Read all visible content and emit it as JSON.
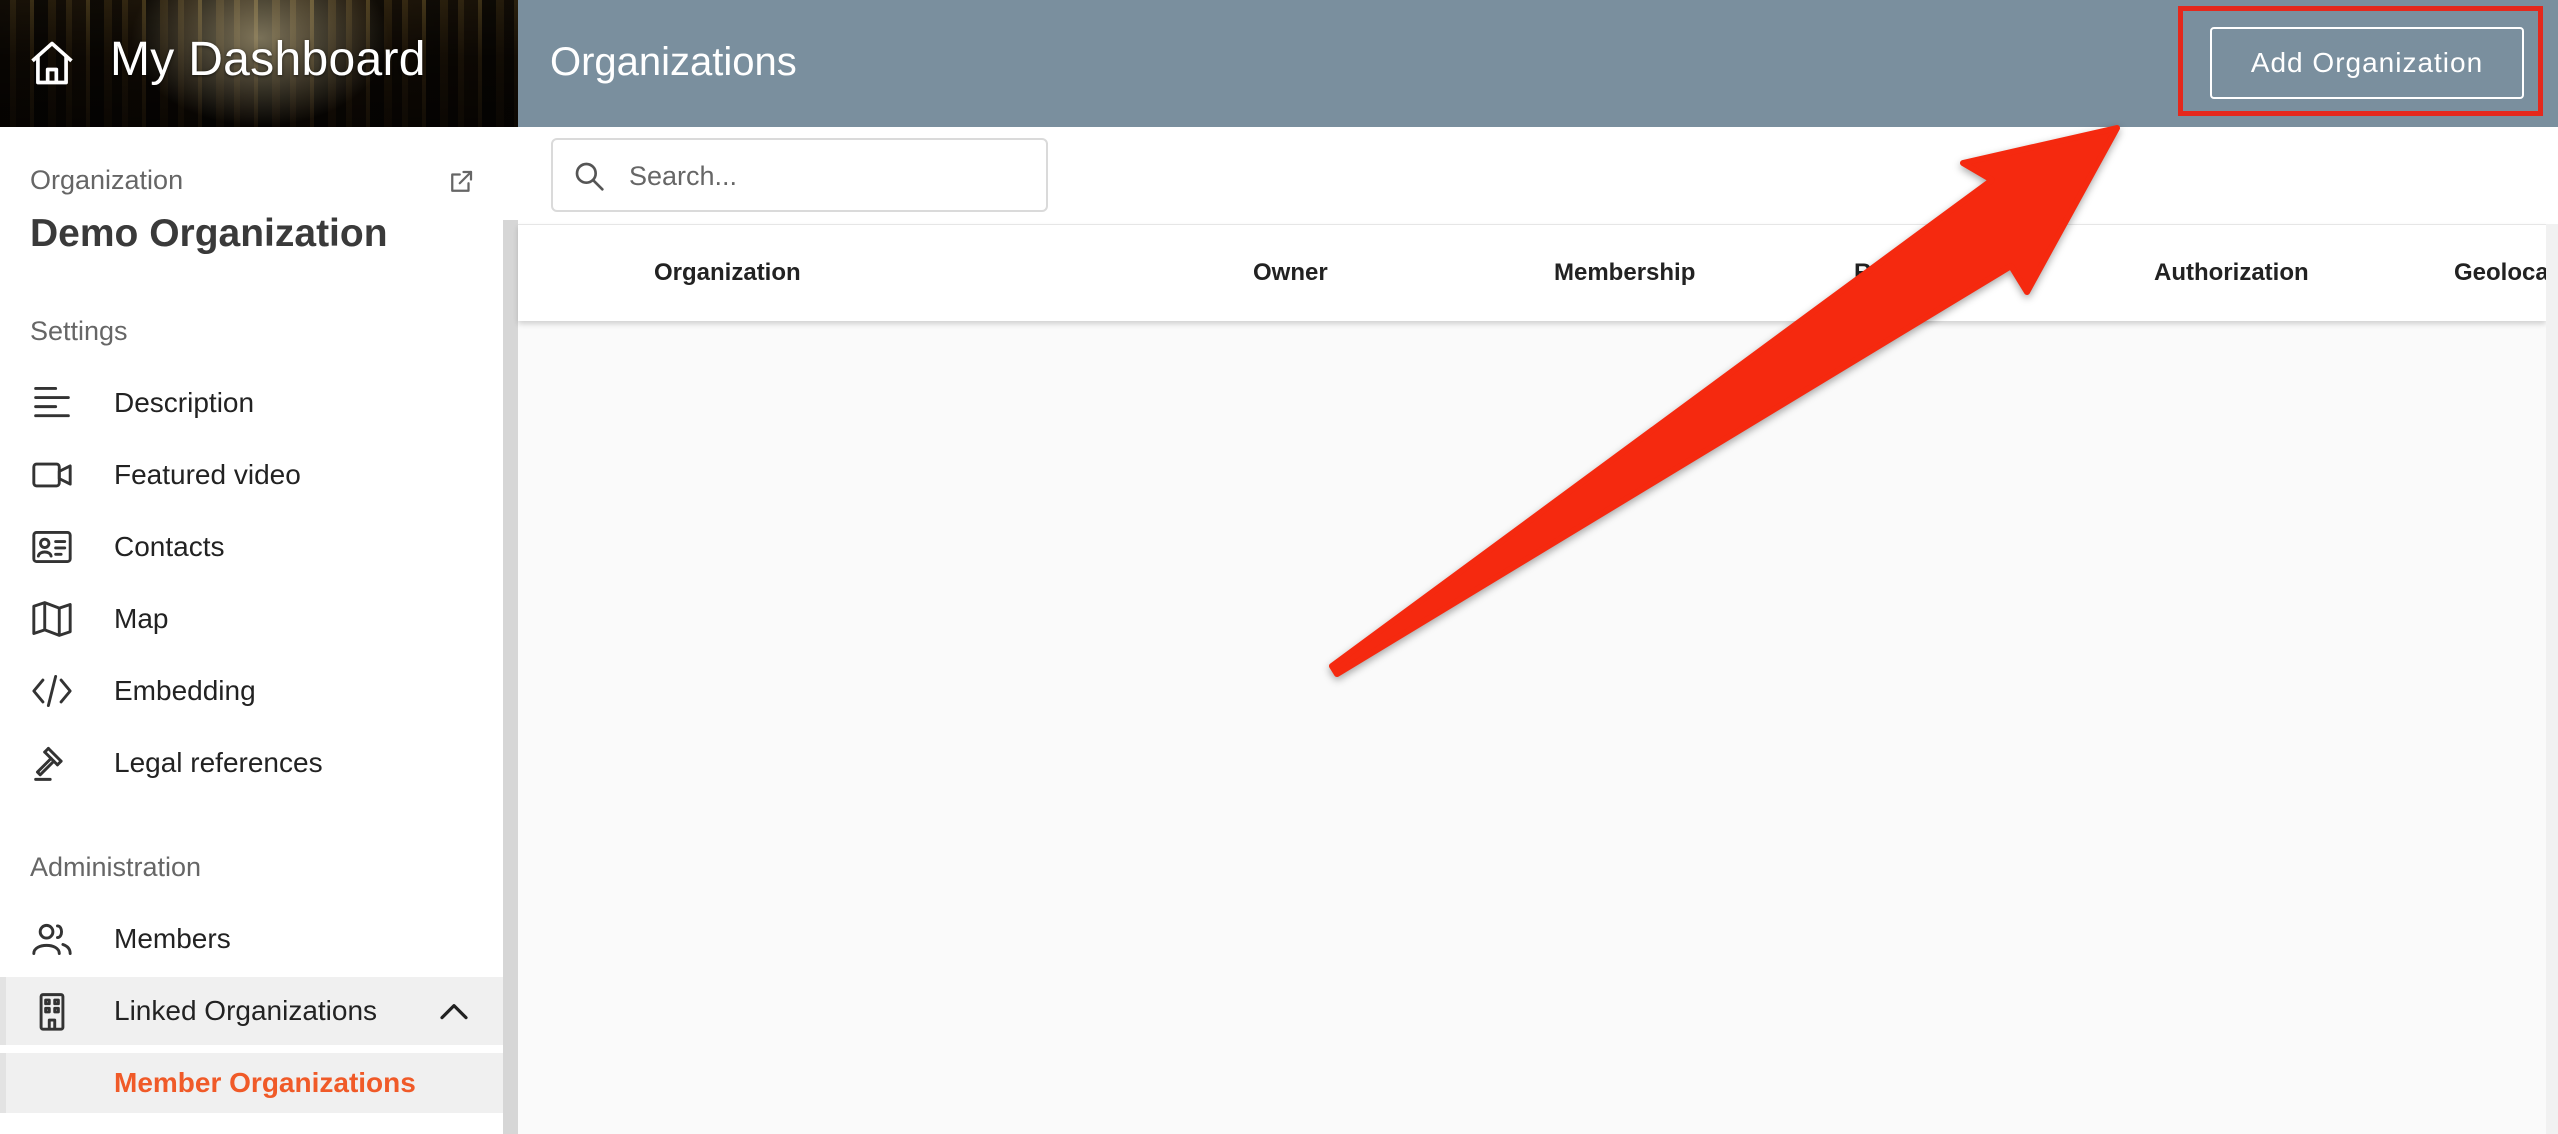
{
  "brand": {
    "title": "My Dashboard"
  },
  "sidebar": {
    "organization_label": "Organization",
    "organization_name": "Demo Organization",
    "settings_title": "Settings",
    "settings_items": [
      {
        "label": "Description",
        "icon": "text-align-left-icon"
      },
      {
        "label": "Featured video",
        "icon": "video-camera-icon"
      },
      {
        "label": "Contacts",
        "icon": "contact-card-icon"
      },
      {
        "label": "Map",
        "icon": "map-icon"
      },
      {
        "label": "Embedding",
        "icon": "code-icon"
      },
      {
        "label": "Legal references",
        "icon": "gavel-icon"
      }
    ],
    "administration_title": "Administration",
    "administration_items": [
      {
        "label": "Members",
        "icon": "users-icon"
      },
      {
        "label": "Linked Organizations",
        "icon": "building-icon"
      }
    ],
    "sub_item": {
      "label": "Member Organizations"
    }
  },
  "header": {
    "title": "Organizations",
    "add_button_label": "Add Organization"
  },
  "search": {
    "placeholder": "Search...",
    "value": ""
  },
  "table": {
    "columns": [
      "Organization",
      "Owner",
      "Membership",
      "Relation",
      "Authorization",
      "Geolocation"
    ]
  },
  "colors": {
    "accent": "#f05a28",
    "header_bg": "#7a8f9e",
    "annotation": "#e5281c"
  }
}
